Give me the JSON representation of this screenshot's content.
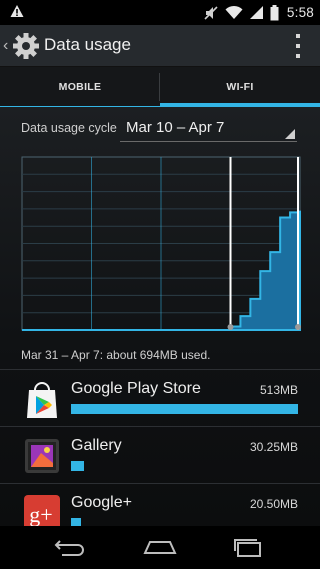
{
  "status_bar": {
    "time": "5:58",
    "icons": [
      "warning-icon",
      "mute-icon",
      "wifi-icon",
      "signal-icon",
      "battery-icon"
    ]
  },
  "action_bar": {
    "title": "Data usage",
    "icons": [
      "up-caret-icon",
      "gear-icon",
      "overflow-menu-icon"
    ]
  },
  "tabs": [
    {
      "label": "MOBILE",
      "active": false
    },
    {
      "label": "WI-FI",
      "active": true
    }
  ],
  "cycle": {
    "label": "Data usage cycle",
    "value": "Mar 10 – Apr 7"
  },
  "chart_data": {
    "type": "area",
    "title": "",
    "xlabel": "",
    "ylabel": "",
    "period_start": "Mar 10",
    "period_end": "Apr 7",
    "selected_range": [
      "Mar 31",
      "Apr 7"
    ],
    "series": [
      {
        "values": [
          0,
          0,
          0,
          0,
          0,
          0,
          0,
          0,
          0,
          0,
          0,
          0,
          0,
          0,
          0,
          0,
          0,
          0,
          0,
          0,
          0,
          0.02,
          0.08,
          0.18,
          0.34,
          0.45,
          0.65,
          0.68,
          0.69
        ]
      }
    ],
    "colors": {
      "line": "#33b5e5",
      "fill": "#1b6fa0",
      "grid": "#33b5e5",
      "marker": "#ffffff"
    },
    "grid": true
  },
  "summary": "Mar 31 – Apr 7: about 694MB used.",
  "apps": [
    {
      "name": "Google Play Store",
      "size": "513MB",
      "fraction": 1.0,
      "icon": "play-store-icon"
    },
    {
      "name": "Gallery",
      "size": "30.25MB",
      "fraction": 0.059,
      "icon": "gallery-icon"
    },
    {
      "name": "Google+",
      "size": "20.50MB",
      "fraction": 0.04,
      "icon": "google-plus-icon"
    }
  ],
  "nav": {
    "icons": [
      "back-icon",
      "home-icon",
      "recents-icon"
    ]
  },
  "colors": {
    "accent": "#33b5e5",
    "background": "#000000"
  }
}
